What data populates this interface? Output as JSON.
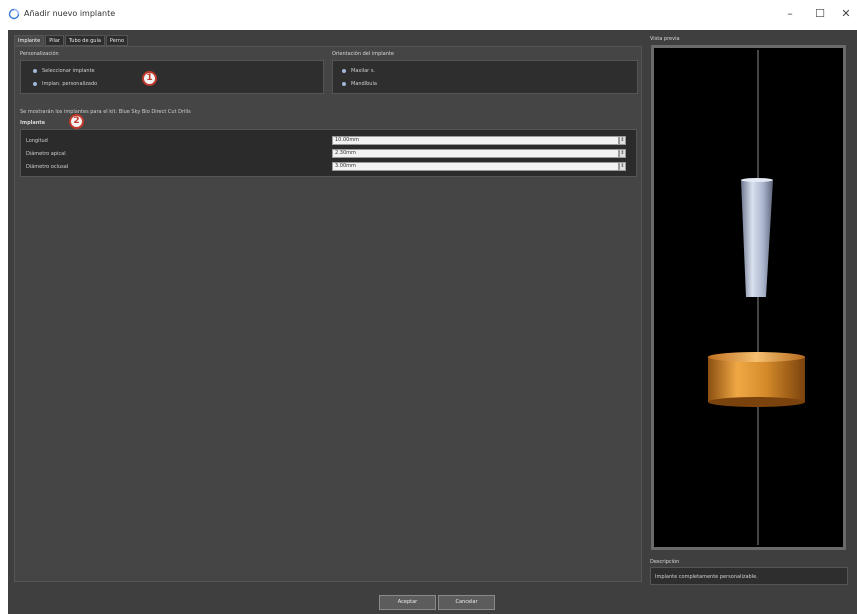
{
  "window": {
    "title": "Añadir nuevo implante",
    "minimize": "–",
    "maximize": "☐",
    "close": "✕",
    "icon": "app-icon"
  },
  "tabs": [
    {
      "label": "Implante",
      "active": true
    },
    {
      "label": "Pilar",
      "active": false
    },
    {
      "label": "Tubo de guía",
      "active": false
    },
    {
      "label": "Perno",
      "active": false
    }
  ],
  "personalization": {
    "label": "Personalización",
    "options": [
      "Seleccionar implante",
      "Implan. personalizado"
    ],
    "badge": "1"
  },
  "orientation": {
    "label": "Orientación del implante",
    "options": [
      "Maxilar s.",
      "Mandíbula"
    ]
  },
  "info_text": "Se mostrarán los implantes para el kit: Blue Sky Bio Direct Cut Drills",
  "implant": {
    "label": "Implante",
    "badge": "2",
    "rows": [
      {
        "label": "Longitud",
        "value": "10.00mm"
      },
      {
        "label": "Diámetro apical",
        "value": "2.30mm"
      },
      {
        "label": "Diámetro oclusal",
        "value": "3.00mm"
      }
    ]
  },
  "preview": {
    "label": "Vista previa"
  },
  "description": {
    "label": "Descripción",
    "text": "Implante completamente personalizable."
  },
  "buttons": {
    "accept": "Aceptar",
    "cancel": "Cancelar"
  },
  "colors": {
    "background": "#3f3f3f",
    "implant_body": "#a9b4cc",
    "drill_stop": "#d48a2a"
  }
}
